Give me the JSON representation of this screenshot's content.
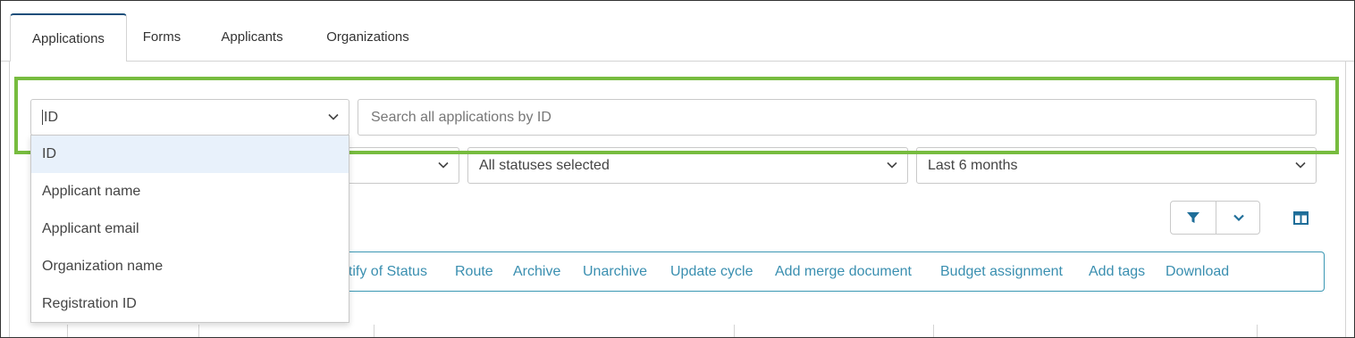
{
  "tabs": [
    {
      "label": "Applications",
      "active": true
    },
    {
      "label": "Forms"
    },
    {
      "label": "Applicants"
    },
    {
      "label": "Organizations"
    }
  ],
  "search": {
    "field_select_value": "ID",
    "placeholder": "Search all applications by ID"
  },
  "dropdown": {
    "options": [
      "ID",
      "Applicant name",
      "Applicant email",
      "Organization name",
      "Registration ID"
    ],
    "highlighted": "ID"
  },
  "filters": {
    "status": "All statuses selected",
    "date_range": "Last 6 months"
  },
  "toolbar": {
    "filter_icon": "filter-icon",
    "expand_icon": "chevron-down-icon",
    "columns_icon": "columns-icon"
  },
  "actions": [
    "otify of Status",
    "Route",
    "Archive",
    "Unarchive",
    "Update cycle",
    "Add merge document",
    "Budget assignment",
    "Add tags",
    "Download"
  ],
  "colors": {
    "accent_link": "#3a8fb0",
    "highlight_box": "#77bc3f",
    "icon_blue": "#1f6e99"
  }
}
